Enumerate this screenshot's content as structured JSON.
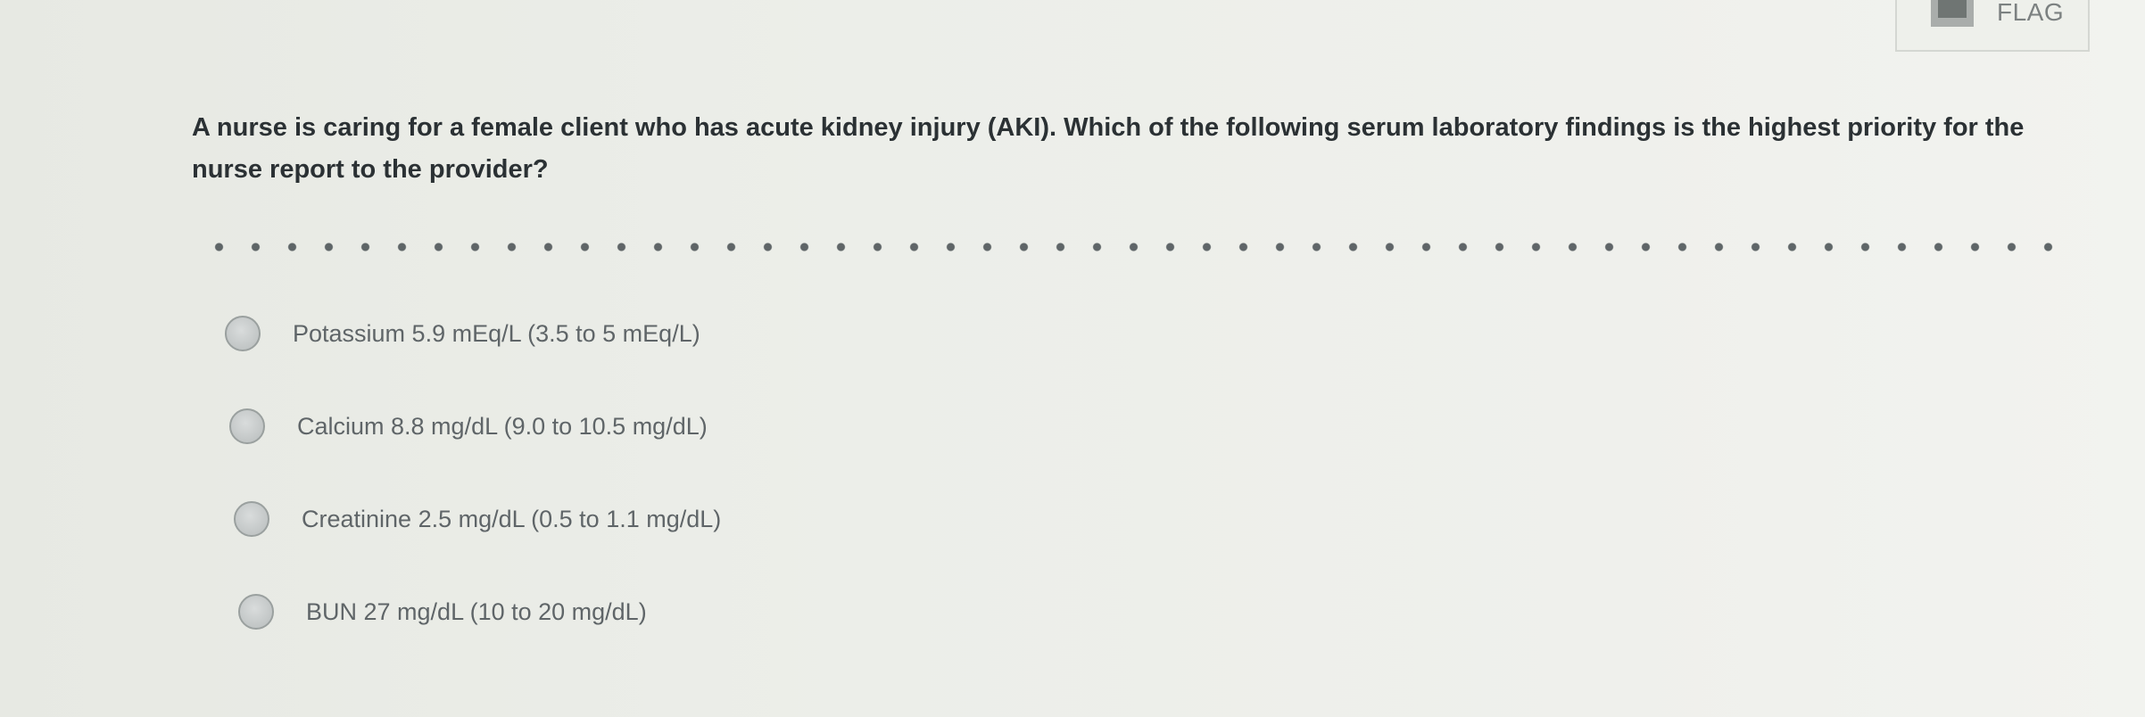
{
  "flag": {
    "label": "FLAG",
    "icon": "bookmark-icon"
  },
  "question": {
    "text": "A nurse is caring for a female client who has acute kidney injury (AKI). Which of the following serum laboratory findings is the highest priority for the nurse report to the provider?"
  },
  "options": [
    {
      "label": "Potassium 5.9 mEq/L (3.5 to 5 mEq/L)",
      "selected": false
    },
    {
      "label": "Calcium 8.8 mg/dL (9.0 to 10.5 mg/dL)",
      "selected": false
    },
    {
      "label": "Creatinine 2.5 mg/dL (0.5 to 1.1 mg/dL)",
      "selected": false
    },
    {
      "label": "BUN 27 mg/dL (10 to 20 mg/dL)",
      "selected": false
    }
  ]
}
